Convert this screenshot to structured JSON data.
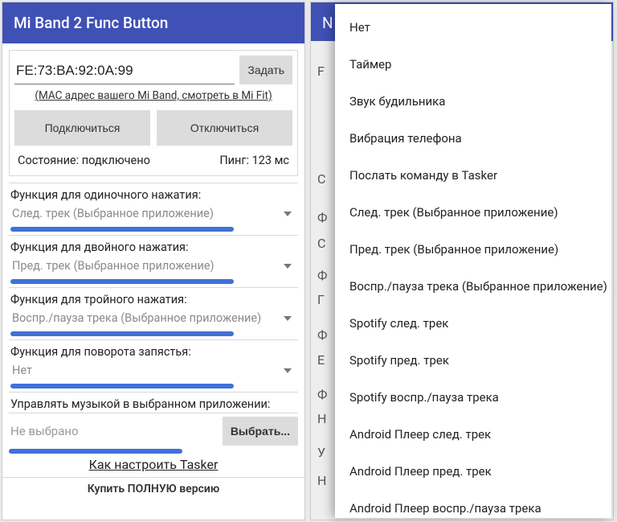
{
  "colors": {
    "primary": "#3f51b5",
    "accent": "#3f72d8"
  },
  "left": {
    "title": "Mi Band 2 Func Button",
    "mac_value": "FE:73:BA:92:0A:99",
    "set_btn": "Задать",
    "mac_hint": "(MAC адрес вашего Mi Band, смотреть в Mi Fit)",
    "connect_btn": "Подключиться",
    "disconnect_btn": "Отключиться",
    "status_label": "Состояние: подключено",
    "ping_label": "Пинг: 123 мс",
    "func_single_label": "Функция для одиночного нажатия:",
    "func_single_value": "След. трек (Выбранное приложение)",
    "func_double_label": "Функция для двойного нажатия:",
    "func_double_value": "Пред. трек (Выбранное приложение)",
    "func_triple_label": "Функция для тройного нажатия:",
    "func_triple_value": "Воспр./пауза трека (Выбранное приложение)",
    "func_wrist_label": "Функция для поворота запястья:",
    "func_wrist_value": "Нет",
    "music_label": "Управлять музыкой в выбранном приложении:",
    "music_none": "Не выбрано",
    "choose_btn": "Выбрать...",
    "tasker_link": "Как настроить Tasker",
    "buy_full": "Купить ПОЛНУЮ версию"
  },
  "right": {
    "appbar_letter": "N",
    "ghosts": [
      "F",
      "C",
      "Ф",
      "C",
      "Ф",
      "Г",
      "Ф",
      "Е",
      "Ф",
      "Н",
      "У",
      "Н"
    ],
    "options": [
      "Нет",
      "Таймер",
      "Звук будильника",
      "Вибрация телефона",
      "Послать команду в Tasker",
      "След. трек (Выбранное приложение)",
      "Пред. трек (Выбранное приложение)",
      "Воспр./пауза трека (Выбранное приложение)",
      "Spotify след. трек",
      "Spotify пред. трек",
      "Spotify воспр./пауза трека",
      "Android Плеер след. трек",
      "Android Плеер пред. трек",
      "Android Плеер воспр./пауза трека"
    ]
  }
}
